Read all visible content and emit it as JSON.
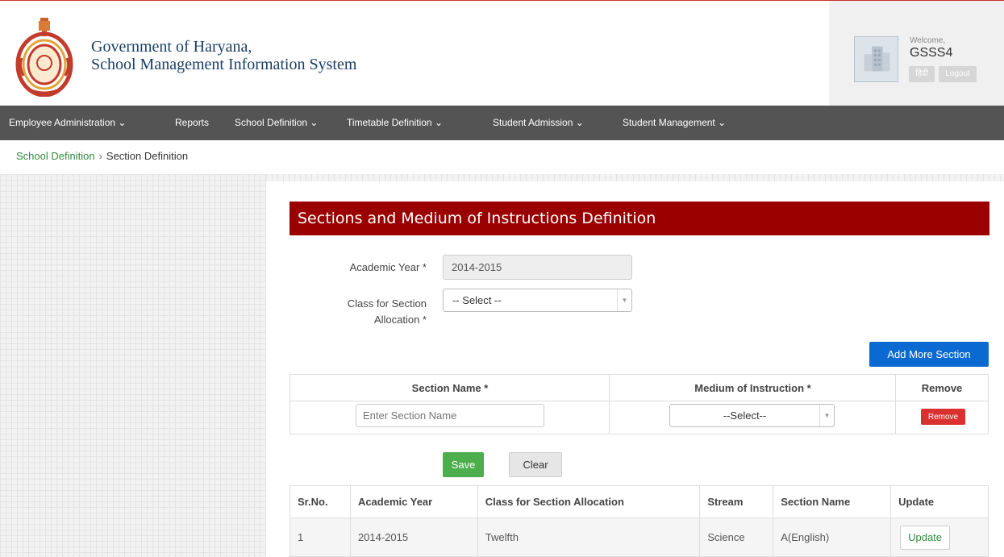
{
  "header": {
    "title_line1": "Government of Haryana,",
    "title_line2": "School Management Information System",
    "welcome": "Welcome,",
    "username": "GSSS4",
    "hindi_label": "हिंदी",
    "logout_label": "Logout"
  },
  "nav": {
    "items": [
      {
        "label": "Employee Administration ⌄"
      },
      {
        "label": "Reports"
      },
      {
        "label": "School Definition ⌄"
      },
      {
        "label": "Timetable Definition ⌄"
      },
      {
        "label": "Student Admission ⌄"
      },
      {
        "label": "Student Management ⌄"
      }
    ]
  },
  "breadcrumb": {
    "parent": "School Definition",
    "separator": "›",
    "current": "Section Definition"
  },
  "form": {
    "title": "Sections and Medium of Instructions Definition",
    "academic_year_label": "Academic Year *",
    "academic_year_value": "2014-2015",
    "class_label_line1": "Class for Section",
    "class_label_line2": "Allocation *",
    "class_select_value": "-- Select --",
    "add_section_label": "Add More Section",
    "section_table": {
      "col_section": "Section Name *",
      "col_medium": "Medium of Instruction *",
      "col_remove": "Remove",
      "section_placeholder": "Enter Section Name",
      "medium_value": "--Select--",
      "remove_label": "Remove"
    },
    "save_label": "Save",
    "clear_label": "Clear"
  },
  "table": {
    "headers": [
      "Sr.No.",
      "Academic Year",
      "Class for Section Allocation",
      "Stream",
      "Section Name",
      "Update"
    ],
    "rows": [
      {
        "sr": "1",
        "year": "2014-2015",
        "class": "Twelfth",
        "stream": "Science",
        "section": "A(English)",
        "update": "Update"
      }
    ]
  },
  "colors": {
    "title_bar": "#9a0000",
    "navbar": "#545454",
    "add_button": "#0a6ad1",
    "save_button": "#4cae4c",
    "remove_button": "#d9312f",
    "link": "#2e8b3a"
  }
}
